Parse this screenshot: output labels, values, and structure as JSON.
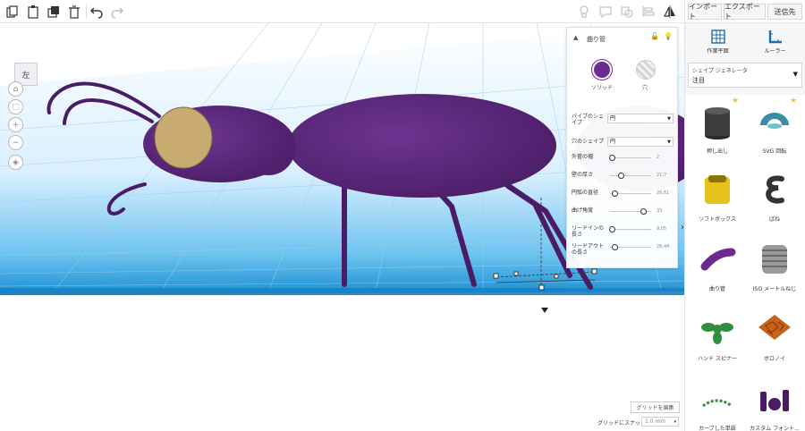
{
  "header": {
    "import_label": "インポート",
    "export_label": "エクスポート",
    "send_label": "送信先"
  },
  "viewport": {
    "view_cube_label": "左",
    "edit_grid_label": "グリッドを編集",
    "snap_label": "グリッドにスナップ",
    "snap_value": "1.0 mm"
  },
  "inspector": {
    "title": "曲り管",
    "solid_label": "ソリッド",
    "hole_label": "穴",
    "pipe_shape_label": "パイプのシェイプ",
    "pipe_shape_value": "円",
    "hole_shape_label": "穴のシェイプ",
    "hole_shape_value": "円",
    "params": [
      {
        "label": "外管の幅",
        "value": "2",
        "pos": 0.05
      },
      {
        "label": "壁の厚さ",
        "value": "21,7",
        "pos": 0.25
      },
      {
        "label": "円弧の直径",
        "value": "26,61",
        "pos": 0.1
      },
      {
        "label": "曲げ角度",
        "value": "33",
        "pos": 0.8
      },
      {
        "label": "リードインの長さ",
        "value": "9,05",
        "pos": 0.05
      },
      {
        "label": "リードアウトの長さ",
        "value": "26,44",
        "pos": 0.1
      }
    ]
  },
  "library": {
    "tool_workplane": "作業平面",
    "tool_ruler": "ルーラー",
    "select_label": "シェイプ ジェネレータ",
    "select_value": "注目",
    "shapes": [
      {
        "label": "押し出し"
      },
      {
        "label": "SVG 回転"
      },
      {
        "label": "ソフトボックス"
      },
      {
        "label": "ばね"
      },
      {
        "label": "曲り管"
      },
      {
        "label": "ISO メートルねじ"
      },
      {
        "label": "ハンド スピナー"
      },
      {
        "label": "ボロノイ"
      },
      {
        "label": "カーブした単語"
      },
      {
        "label": "カスタム フォント..."
      }
    ]
  },
  "colors": {
    "ant_body": "#5a2577",
    "head": "#c9ab72",
    "grid_blue": "#1a8fd1",
    "star": "#f5c518"
  }
}
